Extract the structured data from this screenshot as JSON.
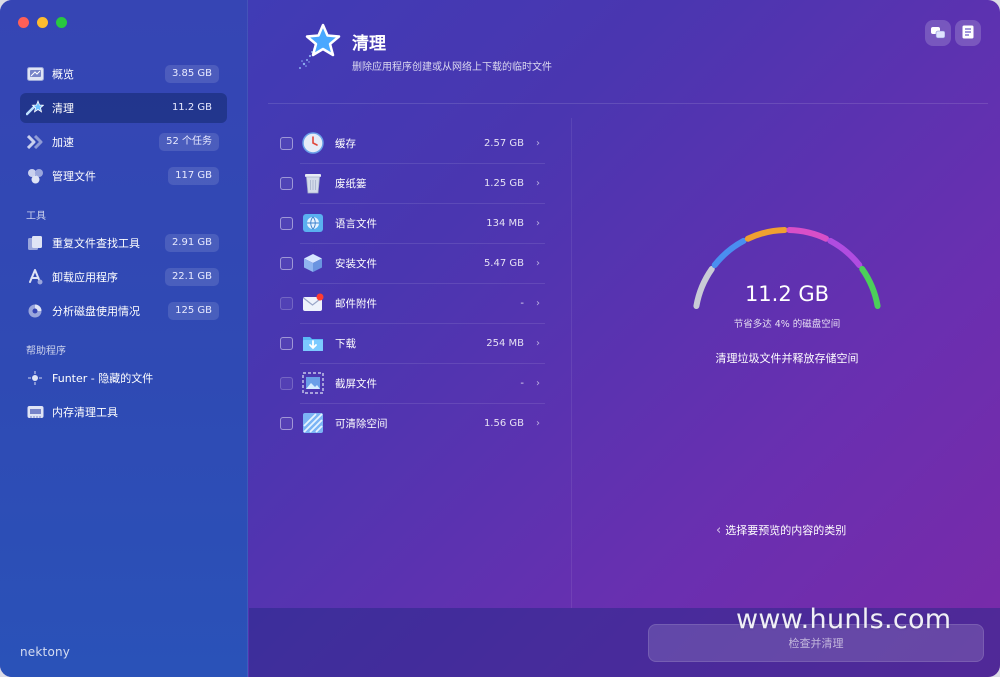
{
  "sidebar": {
    "items": [
      {
        "label": "概览",
        "badge": "3.85 GB",
        "icon": "overview-icon"
      },
      {
        "label": "清理",
        "badge": "11.2 GB",
        "icon": "cleanup-icon",
        "active": true
      },
      {
        "label": "加速",
        "badge": "52 个任务",
        "icon": "speedup-icon"
      },
      {
        "label": "管理文件",
        "badge": "117 GB",
        "icon": "manage-files-icon"
      }
    ],
    "tools_title": "工具",
    "tools": [
      {
        "label": "重复文件查找工具",
        "badge": "2.91 GB",
        "icon": "duplicate-files-icon"
      },
      {
        "label": "卸载应用程序",
        "badge": "22.1 GB",
        "icon": "uninstall-icon"
      },
      {
        "label": "分析磁盘使用情况",
        "badge": "125 GB",
        "icon": "disk-analyzer-icon"
      }
    ],
    "helpers_title": "帮助程序",
    "helpers": [
      {
        "label": "Funter - 隐藏的文件",
        "icon": "funter-icon"
      },
      {
        "label": "内存清理工具",
        "icon": "memory-cleaner-icon"
      }
    ],
    "brand": "nektony"
  },
  "header": {
    "title": "清理",
    "subtitle": "删除应用程序创建或从网络上下载的临时文件"
  },
  "list": [
    {
      "label": "缓存",
      "size": "2.57 GB",
      "icon": "clock-icon",
      "enabled": true
    },
    {
      "label": "废纸篓",
      "size": "1.25 GB",
      "icon": "trash-icon",
      "enabled": true
    },
    {
      "label": "语言文件",
      "size": "134 MB",
      "icon": "language-icon",
      "enabled": true
    },
    {
      "label": "安装文件",
      "size": "5.47 GB",
      "icon": "installer-icon",
      "enabled": true
    },
    {
      "label": "邮件附件",
      "size": "-",
      "icon": "mail-icon",
      "enabled": false
    },
    {
      "label": "下载",
      "size": "254 MB",
      "icon": "download-folder-icon",
      "enabled": true
    },
    {
      "label": "截屏文件",
      "size": "-",
      "icon": "screenshot-icon",
      "enabled": false
    },
    {
      "label": "可清除空间",
      "size": "1.56 GB",
      "icon": "purgeable-icon",
      "enabled": true
    }
  ],
  "gauge": {
    "value": "11.2 GB",
    "subtitle": "节省多达 4% 的磁盘空间",
    "caption": "清理垃圾文件并释放存储空间",
    "segment_colors": [
      "#c9cbd6",
      "#4a8ef0",
      "#f0a030",
      "#d84fc8",
      "#b04ce0",
      "#4ccf5a"
    ]
  },
  "hint": "选择要预览的内容的类别",
  "action_button": "检查并清理",
  "watermark": "www.hunls.com"
}
